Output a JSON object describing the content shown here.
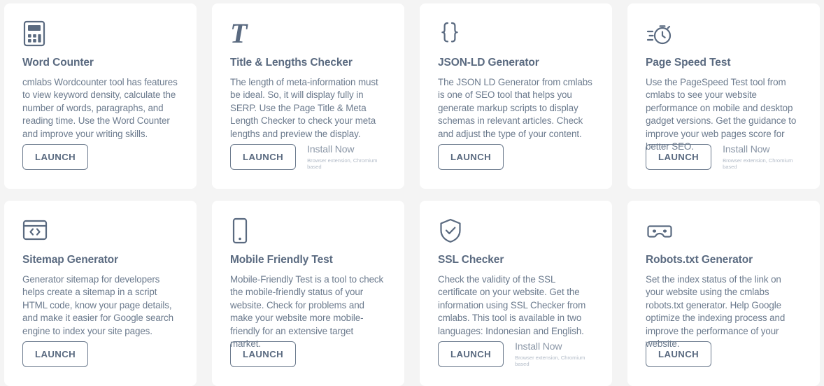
{
  "page": {
    "background_color": "#f4f4f4",
    "card_color": "#ffffff",
    "accent_color": "#5a6a80",
    "body_text_color": "#6b7a8d"
  },
  "common": {
    "launch_label": "LAUNCH",
    "install_title": "Install Now",
    "install_sub": "Browser extension, Chromium based"
  },
  "cards": [
    {
      "icon": "calculator-icon",
      "title": "Word Counter",
      "description": "cmlabs Wordcounter tool has features to view keyword density, calculate the number of words, paragraphs, and reading time. Use the Word Counter and improve your writing skills.",
      "launch_label": "LAUNCH",
      "has_install": false
    },
    {
      "icon": "serif-t-icon",
      "title": "Title & Lengths Checker",
      "description": "The length of meta-information must be ideal. So, it will display fully in SERP. Use the Page Title & Meta Length Checker to check your meta lengths and preview the display.",
      "launch_label": "LAUNCH",
      "has_install": true,
      "install_title": "Install Now",
      "install_sub": "Browser extension, Chromium based"
    },
    {
      "icon": "curly-braces-icon",
      "title": "JSON-LD Generator",
      "description": "The JSON LD Generator from cmlabs is one of SEO tool that helps you generate markup scripts to display schemas in relevant articles. Check and adjust the type of your content.",
      "launch_label": "LAUNCH",
      "has_install": false
    },
    {
      "icon": "stopwatch-icon",
      "title": "Page Speed Test",
      "description": "Use the PageSpeed Test tool from cmlabs to see your website performance on mobile and desktop gadget versions. Get the guidance to improve your web pages score for better SEO.",
      "launch_label": "LAUNCH",
      "has_install": true,
      "install_title": "Install Now",
      "install_sub": "Browser extension, Chromium based"
    },
    {
      "icon": "code-window-icon",
      "title": "Sitemap Generator",
      "description": "Generator sitemap for developers helps create a sitemap in a script HTML code, know your page details, and make it easier for Google search engine to index your site pages.",
      "launch_label": "LAUNCH",
      "has_install": false
    },
    {
      "icon": "mobile-phone-icon",
      "title": "Mobile Friendly Test",
      "description": "Mobile-Friendly Test is a tool to check the mobile-friendly status of your website. Check for problems and make your website more mobile-friendly for an extensive target market.",
      "launch_label": "LAUNCH",
      "has_install": false
    },
    {
      "icon": "shield-check-icon",
      "title": "SSL Checker",
      "description": "Check the validity of the SSL certificate on your website. Get the information using SSL Checker from cmlabs. This tool is available in two languages: Indonesian and English.",
      "launch_label": "LAUNCH",
      "has_install": true,
      "install_title": "Install Now",
      "install_sub": "Browser extension, Chromium based"
    },
    {
      "icon": "robot-face-icon",
      "title": "Robots.txt Generator",
      "description": "Set the index status of the link on your website using the cmlabs robots.txt generator. Help Google optimize the indexing process and improve the performance of your website.",
      "launch_label": "LAUNCH",
      "has_install": false
    }
  ]
}
